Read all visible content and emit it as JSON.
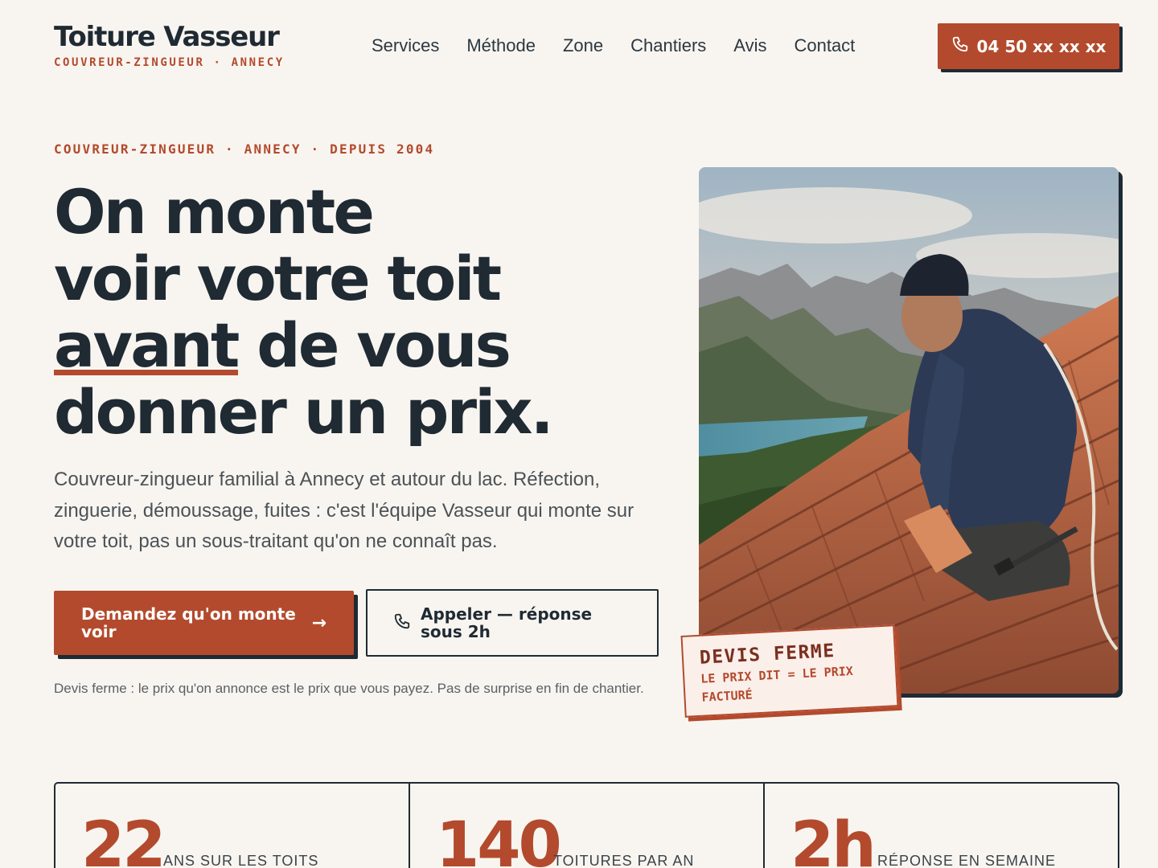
{
  "header": {
    "brand_name": "Toiture Vasseur",
    "brand_tagline": "COUVREUR-ZINGUEUR · ANNECY",
    "nav": [
      "Services",
      "Méthode",
      "Zone",
      "Chantiers",
      "Avis",
      "Contact"
    ],
    "phone": "04 50 xx xx xx"
  },
  "hero": {
    "eyebrow": "COUVREUR-ZINGUEUR · ANNECY · DEPUIS 2004",
    "headline_line1": "On monte",
    "headline_line2": "voir votre toit",
    "headline_line3_emph": "avant",
    "headline_line3_rest": " de vous",
    "headline_line4": "donner un prix.",
    "lead": "Couvreur-zingueur familial à Annecy et autour du lac. Réfection, zinguerie, démoussage, fuites : c'est l'équipe Vasseur qui monte sur votre toit, pas un sous-traitant qu'on ne connaît pas.",
    "cta_primary": "Demandez qu'on monte voir",
    "cta_secondary": "Appeler — réponse sous 2h",
    "note": "Devis ferme : le prix qu'on annonce est le prix que vous payez. Pas de surprise en fin de chantier."
  },
  "stamp": {
    "title": "DEVIS FERME",
    "subtitle": "LE PRIX DIT = LE PRIX FACTURÉ"
  },
  "stats": [
    {
      "number": "22",
      "label": "ANS SUR LES TOITS"
    },
    {
      "number": "140",
      "label": "TOITURES PAR AN"
    },
    {
      "number": "2h",
      "label": "RÉPONSE EN SEMAINE"
    }
  ],
  "colors": {
    "accent": "#b34a2d",
    "ink": "#1f2a33",
    "background": "#f8f5f0"
  }
}
